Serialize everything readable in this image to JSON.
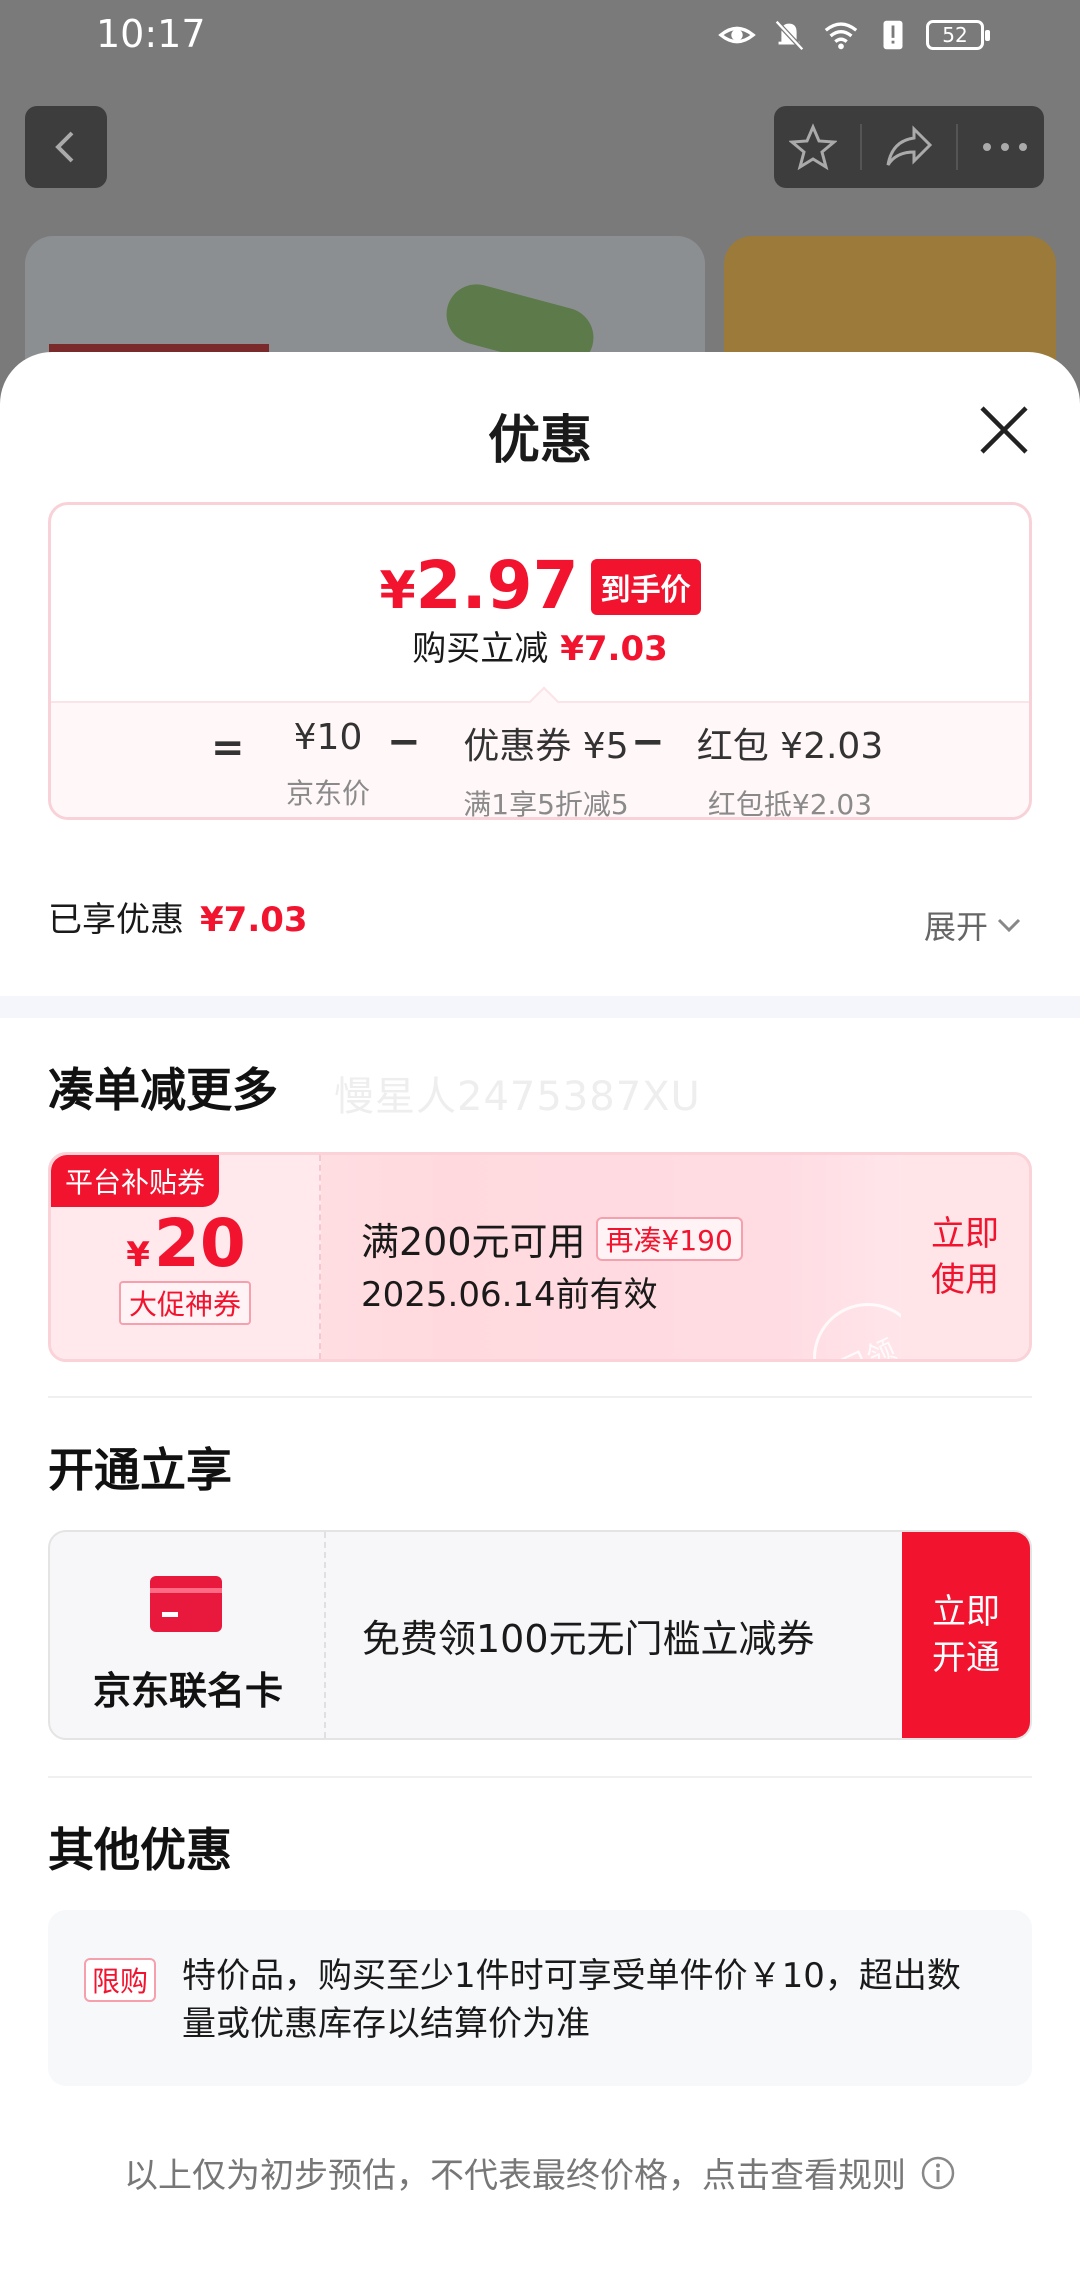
{
  "status_bar": {
    "time": "10:17",
    "battery": "52"
  },
  "sheet": {
    "title": "优惠",
    "price": {
      "yen": "¥",
      "final_amount": "2.97",
      "final_tag": "到手价",
      "reduce_label": "购买立减",
      "reduce_value": "¥7.03",
      "equals": "=",
      "minus": "−",
      "jd_price": "¥10",
      "jd_price_label": "京东价",
      "coupon_main": "优惠券 ¥5",
      "coupon_sub": "满1享5折减5",
      "redpacket_main": "红包 ¥2.03",
      "redpacket_sub": "红包抵¥2.03"
    },
    "enjoyed_label": "已享优惠",
    "enjoyed_value": "¥7.03",
    "expand_label": "展开",
    "section_more": {
      "title": "凑单减更多",
      "watermark": "慢星人2475387XU",
      "coupon": {
        "badge": "平台补贴券",
        "yen": "¥",
        "amount": "20",
        "type": "大促神券",
        "condition": "满200元可用",
        "extra": "再凑¥190",
        "validity": "2025.06.14前有效",
        "action_line1": "立即",
        "action_line2": "使用",
        "stamp": "已领"
      }
    },
    "section_open": {
      "title": "开通立享",
      "card_name": "京东联名卡",
      "description": "免费领100元无门槛立减券",
      "action_line1": "立即",
      "action_line2": "开通"
    },
    "section_other": {
      "title": "其他优惠",
      "tag": "限购",
      "text": "特价品，购买至少1件时可享受单件价￥10，超出数量或优惠库存以结算价为准"
    },
    "footer_note": "以上仅为初步预估，不代表最终价格，点击查看规则"
  },
  "colors": {
    "accent_red": "#f2142f",
    "card_red": "#e8193c"
  }
}
